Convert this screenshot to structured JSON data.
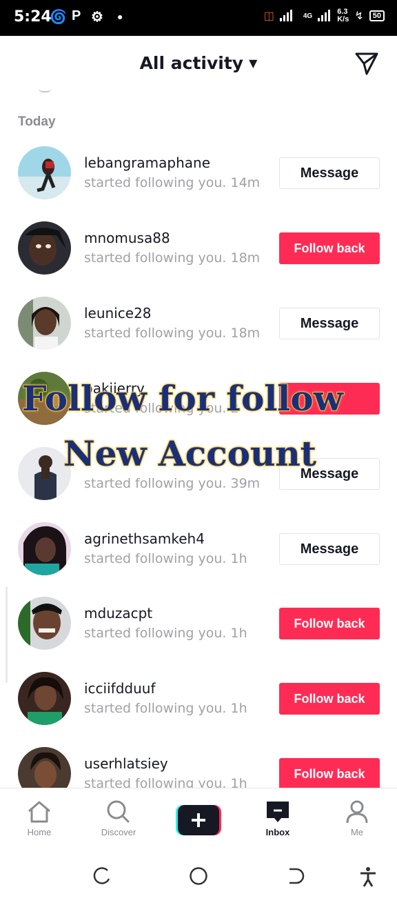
{
  "status_bar": {
    "time": "5:24",
    "speed_top": "6.3",
    "speed_bottom": "K/s",
    "battery": "50",
    "network": "4G"
  },
  "header": {
    "title": "All activity"
  },
  "section_label": "Today",
  "rows": [
    {
      "username": "lebangramaphane",
      "text": "started following you.",
      "time": "14m",
      "button": "Message",
      "button_type": "message"
    },
    {
      "username": "mnomusa88",
      "text": "started following you.",
      "time": "18m",
      "button": "Follow back",
      "button_type": "follow"
    },
    {
      "username": "leunice28",
      "text": "started following you.",
      "time": "18m",
      "button": "Message",
      "button_type": "message"
    },
    {
      "username": "pakiierry",
      "text": "started following you.",
      "time": "2",
      "button": "",
      "button_type": "follow"
    },
    {
      "username": "",
      "text": "started following you.",
      "time": "39m",
      "button": "Message",
      "button_type": "message"
    },
    {
      "username": "agrinethsamkeh4",
      "text": "started following you.",
      "time": "1h",
      "button": "Message",
      "button_type": "message"
    },
    {
      "username": "mduzacpt",
      "text": "started following you.",
      "time": "1h",
      "button": "Follow back",
      "button_type": "follow"
    },
    {
      "username": "icciifdduuf",
      "text": "started following you.",
      "time": "1h",
      "button": "Follow back",
      "button_type": "follow"
    },
    {
      "username": "userhlatsiey",
      "text": "started following you.",
      "time": "1h",
      "button": "Follow back",
      "button_type": "follow"
    }
  ],
  "overlay": {
    "line1": "Follow for follow",
    "line2": "New Account"
  },
  "tabs": {
    "home": "Home",
    "discover": "Discover",
    "inbox": "Inbox",
    "me": "Me"
  },
  "colors": {
    "accent": "#fe2c55",
    "text": "#161823",
    "muted": "#a0a1a7"
  }
}
